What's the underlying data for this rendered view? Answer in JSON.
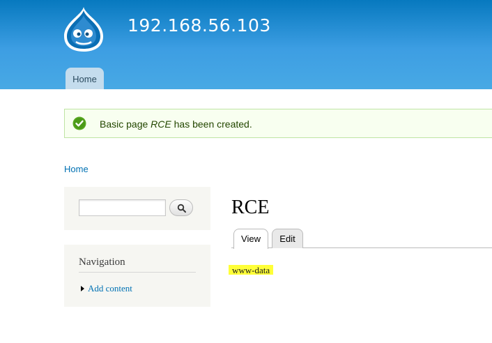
{
  "header": {
    "site_name": "192.168.56.103",
    "logo_icon": "drupal-drop-logo",
    "main_menu": [
      {
        "label": "Home"
      }
    ],
    "colors": {
      "top": "#0779bf",
      "bottom": "#48a9e4"
    }
  },
  "status_message": {
    "icon": "check-circle-icon",
    "prefix": "Basic page",
    "title": "RCE",
    "suffix": "has been created."
  },
  "breadcrumb": {
    "label": "Home"
  },
  "sidebar": {
    "search": {
      "value": "",
      "button_icon": "search-icon"
    },
    "navigation": {
      "title": "Navigation",
      "items": [
        {
          "label": "Add content"
        }
      ]
    }
  },
  "main": {
    "title": "RCE",
    "tabs": [
      {
        "label": "View",
        "active": true
      },
      {
        "label": "Edit",
        "active": false
      }
    ],
    "body": "www-data",
    "highlight_color": "#ffff38"
  }
}
